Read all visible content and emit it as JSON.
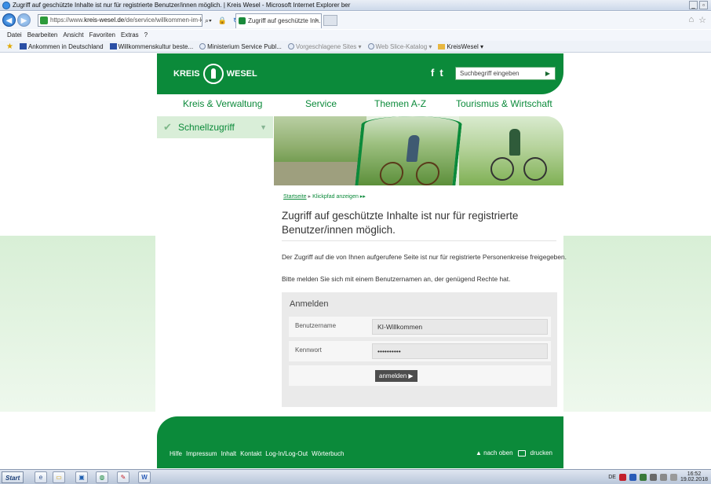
{
  "browser": {
    "window_title": "Zugriff auf geschützte Inhalte ist nur für registrierte Benutzer/innen möglich. | Kreis Wesel - Microsoft Internet Explorer ber",
    "url_prefix": "https://www.",
    "url_host": "kreis-wesel.de",
    "url_path": "/de/service/willkommen-im-kreis-wes",
    "tab_title": "Zugriff auf geschützte Inh...",
    "tab_close": "×",
    "menu": [
      "Datei",
      "Bearbeiten",
      "Ansicht",
      "Favoriten",
      "Extras",
      "?"
    ],
    "favorites": [
      "Ankommen in Deutschland",
      "Willkommenskultur beste...",
      "Ministerium Service Publ...",
      "Vorgeschlagene Sites ▾",
      "Web Slice-Katalog ▾",
      "KreisWesel ▾"
    ]
  },
  "site": {
    "logo_left": "KREIS",
    "logo_right": "WESEL",
    "social_facebook": "f",
    "social_twitter": "t",
    "search_placeholder": "Suchbegriff eingeben",
    "search_go": "▶",
    "nav": [
      "Kreis & Verwaltung",
      "Service",
      "Themen A-Z",
      "Tourismus & Wirtschaft"
    ],
    "quick_access": "Schnellzugriff",
    "breadcrumb_home": "Startseite",
    "breadcrumb_sep": "▸",
    "breadcrumb_toggle": "Klickpfad anzeigen ▸▸",
    "page_title": "Zugriff auf geschützte Inhalte ist nur für registrierte Benutzer/innen möglich.",
    "para1": "Der Zugriff auf die von Ihnen aufgerufene Seite ist nur für registrierte Personenkreise freigegeben.",
    "para2": "Bitte melden Sie sich mit einem Benutzernamen an, der genügend Rechte hat.",
    "login": {
      "heading": "Anmelden",
      "username_label": "Benutzername",
      "username_value": "KI-Willkommen",
      "password_label": "Kennwort",
      "password_value": "••••••••••",
      "submit_label": "anmelden ▶"
    },
    "footer_links": [
      "Hilfe",
      "Impressum",
      "Inhalt",
      "Kontakt",
      "Log-In/Log-Out",
      "Wörterbuch"
    ],
    "footer_top": "▲ nach oben",
    "footer_print": "drucken"
  },
  "taskbar": {
    "start": "Start",
    "lang": "DE",
    "time": "16:52",
    "date": "19.02.2018"
  },
  "colors": {
    "brand_green": "#0b8a3a",
    "light_green": "#d9eed8",
    "login_bg": "#eaeaea"
  }
}
